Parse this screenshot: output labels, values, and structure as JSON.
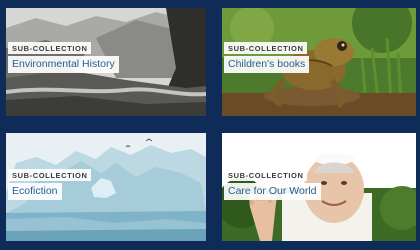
{
  "collections": [
    {
      "tag": "SUB-COLLECTION",
      "title": "Environmental History"
    },
    {
      "tag": "SUB-COLLECTION",
      "title": "Children's books"
    },
    {
      "tag": "SUB-COLLECTION",
      "title": "Ecofiction"
    },
    {
      "tag": "SUB-COLLECTION",
      "title": "Care for Our World"
    }
  ],
  "colors": {
    "background": "#0f2b57",
    "title_text": "#23618f",
    "tag_text": "#3b3b3b"
  }
}
